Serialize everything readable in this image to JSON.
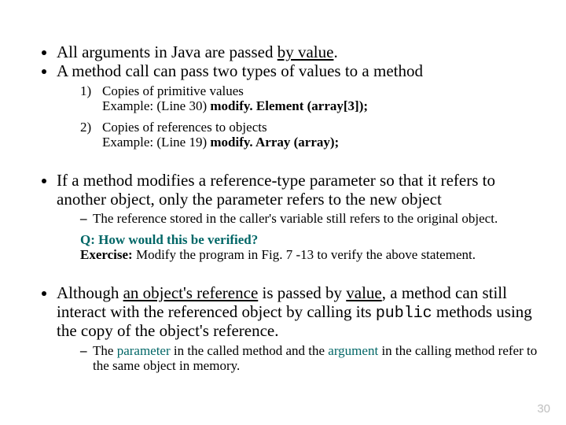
{
  "bullets": {
    "b1_pre": "All arguments in Java are passed ",
    "b1_by_value": "by value",
    "b1_post": ".",
    "b2": "A method call can pass two types of values to a method",
    "b3": "If a method modifies a reference-type parameter so that it refers to another object, only the parameter refers to the new object",
    "b4_pre": "Although ",
    "b4_ref": "an object's reference",
    "b4_mid1": " is passed by ",
    "b4_value": "value",
    "b4_mid2": ", a method can still interact with the referenced object by calling its ",
    "b4_public": "public",
    "b4_post": " methods using the copy of the object's reference."
  },
  "sub1": {
    "n1": "1)",
    "t1a": "Copies of primitive values",
    "t1b_pre": "Example: (Line 30) ",
    "t1b_bold": "modify. Element (array[3]);",
    "n2": "2)",
    "t2a": "Copies of references to objects",
    "t2b_pre": "Example: (Line 19) ",
    "t2b_bold": "modify. Array (array);"
  },
  "sub3": {
    "dash": "–",
    "d1": "The reference stored in the caller's variable still refers to the original object.",
    "q_label": "Q: ",
    "q_text": "How would this be verified?",
    "ex_label": "Exercise: ",
    "ex_text": "Modify the program in Fig. 7 -13 to verify the above statement."
  },
  "sub4": {
    "dash": "–",
    "d_pre": "The ",
    "d_param": "parameter",
    "d_mid1": " in the called method and the ",
    "d_arg": "argument",
    "d_post": " in the calling method refer to the same object in memory."
  },
  "page": "30"
}
